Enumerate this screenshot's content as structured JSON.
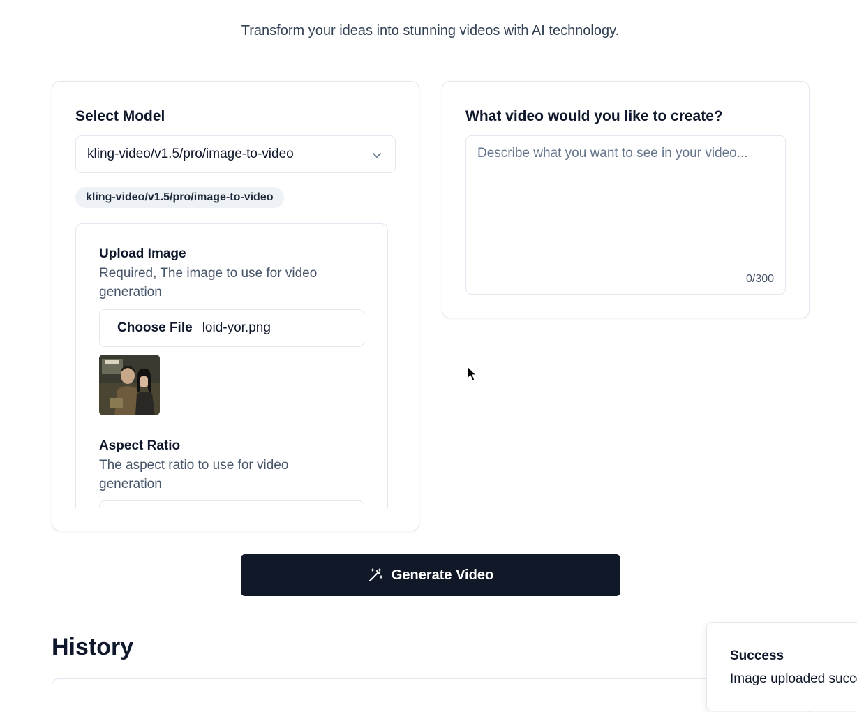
{
  "header": {
    "tagline": "Transform your ideas into stunning videos with AI technology."
  },
  "model_panel": {
    "label": "Select Model",
    "selected_model": "kling-video/v1.5/pro/image-to-video",
    "badge": "kling-video/v1.5/pro/image-to-video",
    "params": {
      "upload": {
        "title": "Upload Image",
        "description": "Required, The image to use for video generation",
        "button_label": "Choose File",
        "file_name": "loid-yor.png"
      },
      "aspect_ratio": {
        "title": "Aspect Ratio",
        "description": "The aspect ratio to use for video generation"
      }
    }
  },
  "prompt_panel": {
    "label": "What video would you like to create?",
    "placeholder": "Describe what you want to see in your video...",
    "counter": "0/300"
  },
  "generate_button": {
    "label": "Generate Video"
  },
  "history": {
    "title": "History"
  },
  "toast": {
    "title": "Success",
    "message": "Image uploaded successfully"
  },
  "colors": {
    "primary_button": "#111827",
    "border": "#e2e8f0",
    "muted_text": "#475569"
  }
}
